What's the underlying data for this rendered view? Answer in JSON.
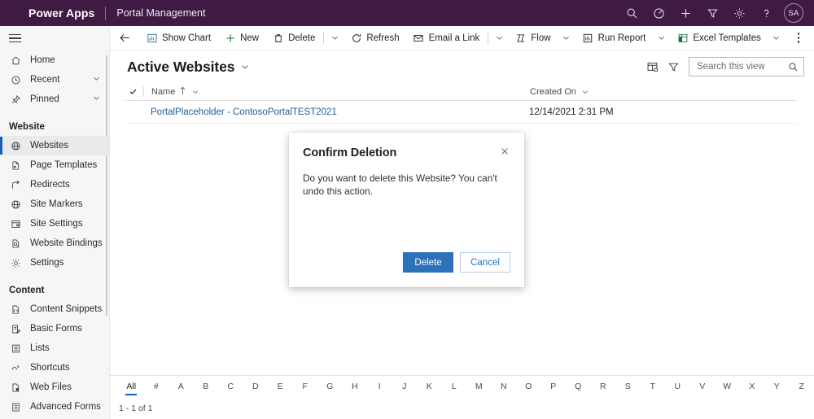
{
  "header": {
    "brand": "Power Apps",
    "app_name": "Portal Management",
    "avatar_initials": "SA",
    "icons": [
      {
        "name": "search-icon",
        "label": "Search"
      },
      {
        "name": "timer-icon",
        "label": "Settings"
      },
      {
        "name": "plus-icon",
        "label": "New"
      },
      {
        "name": "filter-icon",
        "label": "Filter"
      },
      {
        "name": "gear-icon",
        "label": "Settings"
      },
      {
        "name": "help-icon",
        "label": "Help"
      }
    ]
  },
  "sidebar": {
    "top_items": [
      {
        "label": "Home",
        "icon": "home-icon",
        "chevron": false
      },
      {
        "label": "Recent",
        "icon": "clock-icon",
        "chevron": true
      },
      {
        "label": "Pinned",
        "icon": "pin-icon",
        "chevron": true
      }
    ],
    "groups": [
      {
        "title": "Website",
        "items": [
          {
            "label": "Websites",
            "icon": "globe-icon",
            "selected": true
          },
          {
            "label": "Page Templates",
            "icon": "page-icon",
            "selected": false
          },
          {
            "label": "Redirects",
            "icon": "redirect-icon",
            "selected": false
          },
          {
            "label": "Site Markers",
            "icon": "globe-icon",
            "selected": false
          },
          {
            "label": "Site Settings",
            "icon": "site-settings-icon",
            "selected": false
          },
          {
            "label": "Website Bindings",
            "icon": "binding-icon",
            "selected": false
          },
          {
            "label": "Settings",
            "icon": "gear-icon",
            "selected": false
          }
        ]
      },
      {
        "title": "Content",
        "items": [
          {
            "label": "Content Snippets",
            "icon": "snippet-icon",
            "selected": false
          },
          {
            "label": "Basic Forms",
            "icon": "form-icon",
            "selected": false
          },
          {
            "label": "Lists",
            "icon": "list-icon",
            "selected": false
          },
          {
            "label": "Shortcuts",
            "icon": "shortcut-icon",
            "selected": false
          },
          {
            "label": "Web Files",
            "icon": "file-icon",
            "selected": false
          },
          {
            "label": "Advanced Forms",
            "icon": "advanced-form-icon",
            "selected": false
          }
        ]
      }
    ]
  },
  "commandbar": {
    "back": "back-arrow-icon",
    "items": [
      {
        "label": "Show Chart",
        "icon": "chart-icon",
        "caret": false
      },
      {
        "label": "New",
        "icon": "plus-icon",
        "caret": false
      },
      {
        "label": "Delete",
        "icon": "trash-icon",
        "caret": true,
        "divider_before_caret": true
      },
      {
        "label": "Refresh",
        "icon": "refresh-icon",
        "caret": false
      },
      {
        "label": "Email a Link",
        "icon": "email-link-icon",
        "caret": true,
        "divider_before_caret": true
      },
      {
        "label": "Flow",
        "icon": "flow-icon",
        "caret": true
      },
      {
        "label": "Run Report",
        "icon": "report-icon",
        "caret": true
      },
      {
        "label": "Excel Templates",
        "icon": "excel-icon",
        "caret": true
      }
    ],
    "overflow": "more-commands-icon"
  },
  "view": {
    "title": "Active Websites",
    "edit_columns_icon": "edit-columns-icon",
    "filter_icon": "filter-icon",
    "search_placeholder": "Search this view"
  },
  "grid": {
    "columns": [
      {
        "label": "Name",
        "sorted": true,
        "sort_dir": "asc"
      },
      {
        "label": "Created On",
        "sorted": false,
        "sort_dir": ""
      }
    ],
    "rows": [
      {
        "name": "PortalPlaceholder - ContosoPortalTEST2021",
        "created_on": "12/14/2021 2:31 PM"
      }
    ]
  },
  "alpha_filter": {
    "selected": "All",
    "items": [
      "All",
      "#",
      "A",
      "B",
      "C",
      "D",
      "E",
      "F",
      "G",
      "H",
      "I",
      "J",
      "K",
      "L",
      "M",
      "N",
      "O",
      "P",
      "Q",
      "R",
      "S",
      "T",
      "U",
      "V",
      "W",
      "X",
      "Y",
      "Z"
    ]
  },
  "status": {
    "record_count": "1 - 1 of 1"
  },
  "dialog": {
    "title": "Confirm Deletion",
    "message": "Do you want to delete this Website? You can't undo this action.",
    "close_icon": "close-icon",
    "primary_button": "Delete",
    "secondary_button": "Cancel"
  },
  "colors": {
    "header_bg": "#3f1a43",
    "accent": "#1160c4",
    "primary_button": "#2b72bb",
    "link": "#245d99"
  }
}
